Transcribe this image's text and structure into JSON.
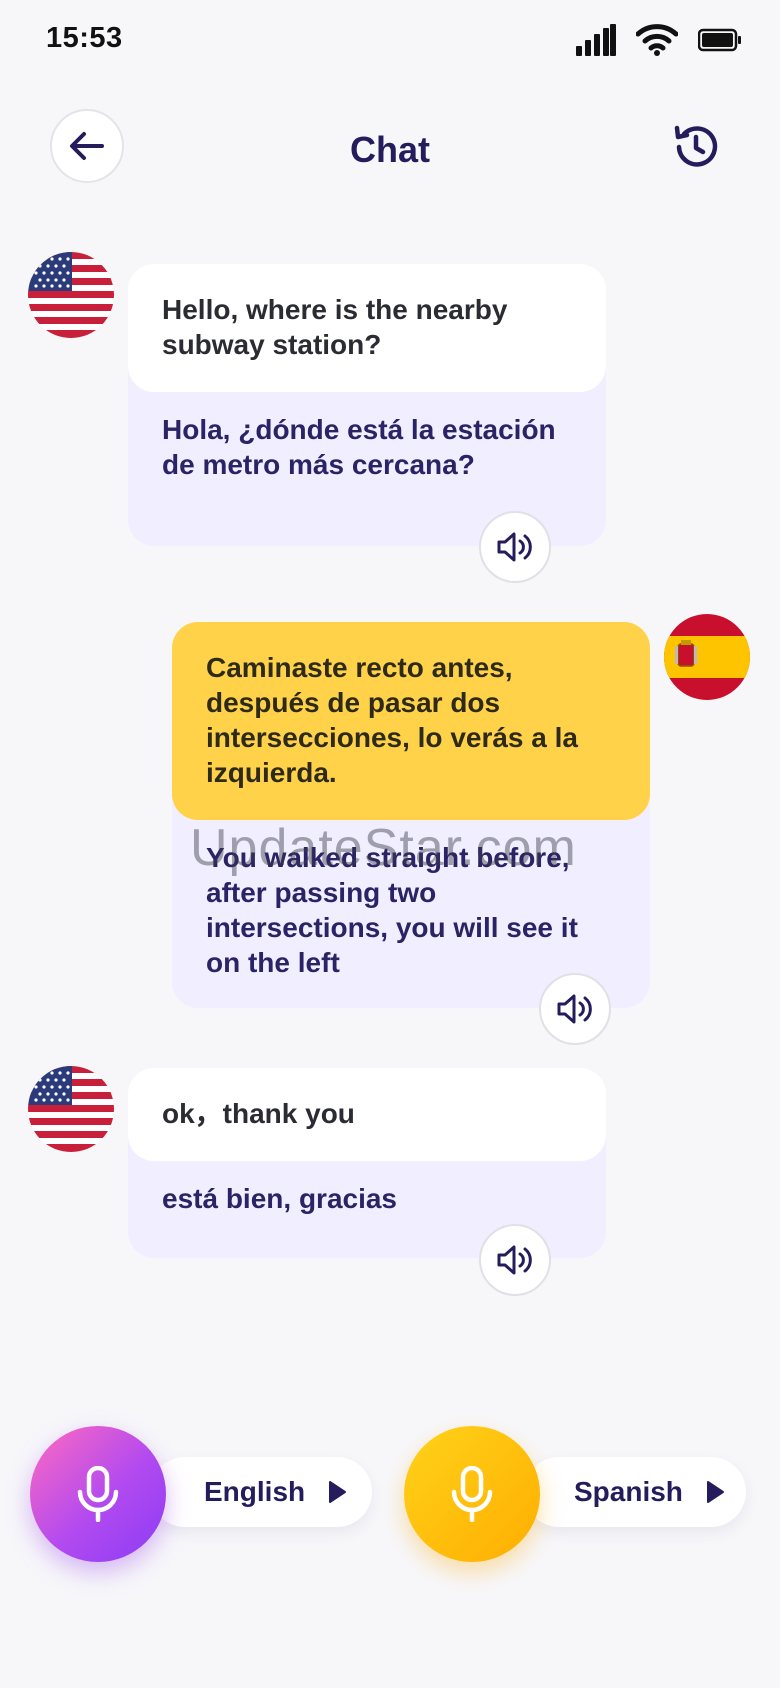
{
  "status": {
    "time": "15:53"
  },
  "header": {
    "title": "Chat"
  },
  "messages": [
    {
      "side": "left",
      "flag": "us-flag",
      "original": "Hello, where is the nearby subway station?",
      "translation": "Hola, ¿dónde está la estación de metro más cercana?"
    },
    {
      "side": "right",
      "flag": "spain-flag",
      "original": "Caminaste recto antes, después de pasar dos intersecciones, lo verás a la izquierda.",
      "translation": "You walked straight before, after passing two intersections, you will see it on the left"
    },
    {
      "side": "left",
      "flag": "us-flag",
      "original": "ok，thank you",
      "translation": "está bien, gracias"
    }
  ],
  "watermark": "UpdateStar.com",
  "controls": {
    "left_language": "English",
    "right_language": "Spanish"
  },
  "colors": {
    "accent": "#241c5c",
    "yellow": "#ffd24a",
    "bubble_bg": "#f1efff"
  },
  "icons": [
    "back-arrow-icon",
    "history-icon",
    "speaker-icon",
    "microphone-icon",
    "play-triangle-icon"
  ]
}
